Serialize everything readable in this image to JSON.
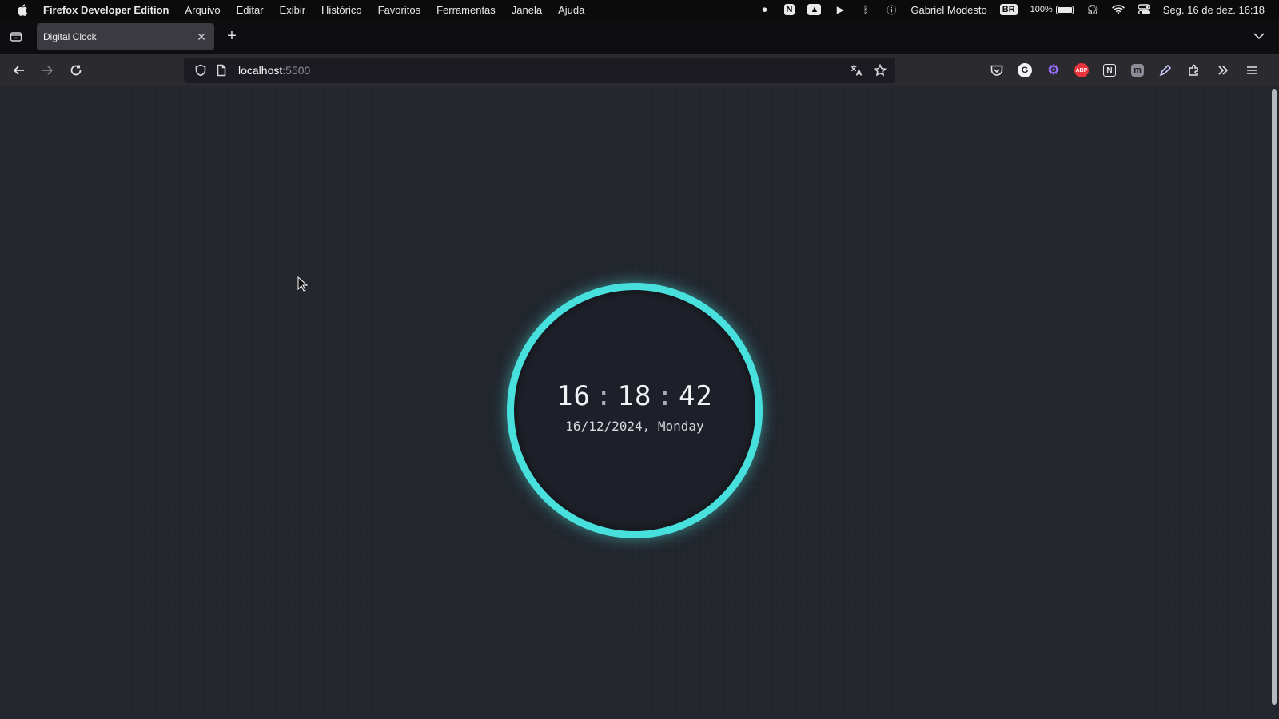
{
  "menubar": {
    "app_name": "Firefox Developer Edition",
    "menus": [
      "Arquivo",
      "Editar",
      "Exibir",
      "Histórico",
      "Favoritos",
      "Ferramentas",
      "Janela",
      "Ajuda"
    ],
    "user": "Gabriel Modesto",
    "input_source": "BR",
    "battery_percent": "100%",
    "datetime": "Seg. 16 de dez.  16:18"
  },
  "tab": {
    "title": "Digital Clock",
    "new_tab_label": "+"
  },
  "url": {
    "host": "localhost",
    "port": ":5500"
  },
  "clock": {
    "hours": "16",
    "minutes": "18",
    "seconds": "42",
    "separator": ":",
    "date": "16/12/2024, Monday",
    "ring_color": "#47e0dc"
  },
  "extensions": [
    "pocket-icon",
    "grammarly-icon",
    "gear-extension-icon",
    "adblock-icon",
    "notion-icon",
    "mastodon-icon",
    "pen-icon",
    "extensions-icon",
    "overflow-icon",
    "menu-icon"
  ],
  "extension_labels": {
    "grammarly": "G",
    "adblock": "ABP",
    "notion": "N",
    "mastodon": "m"
  }
}
